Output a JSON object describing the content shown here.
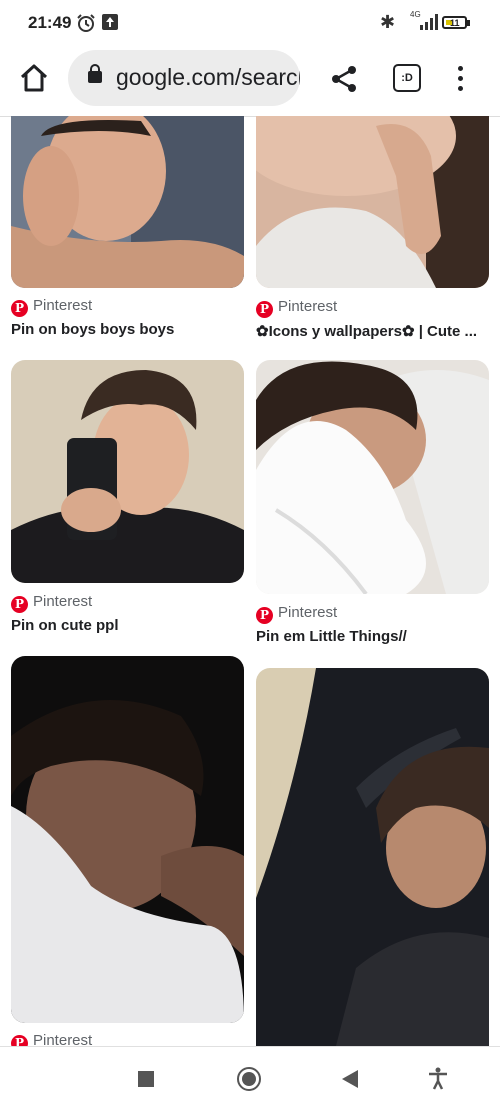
{
  "status_bar": {
    "time": "21:49",
    "network": "4G",
    "battery": "11"
  },
  "browser": {
    "url": "google.com/search",
    "tabs_label": ":D"
  },
  "results": [
    {
      "source": "Pinterest",
      "title": "Pin on boys boys boys"
    },
    {
      "source": "Pinterest",
      "title": "✿Icons y wallpapers✿ | Cute ..."
    },
    {
      "source": "Pinterest",
      "title": "Pin on cute ppl"
    },
    {
      "source": "Pinterest",
      "title": "Pin em Little Things//"
    },
    {
      "source": "Pinterest",
      "title": ""
    },
    {
      "source": "",
      "title": ""
    }
  ]
}
